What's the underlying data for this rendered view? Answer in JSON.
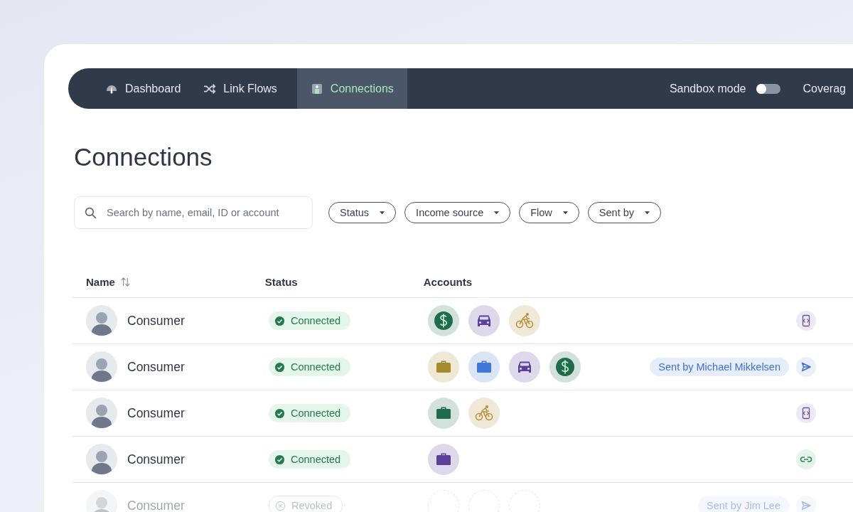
{
  "nav": {
    "tabs": [
      {
        "label": "Dashboard",
        "kind": "gauge",
        "selected": false
      },
      {
        "label": "Link Flows",
        "kind": "shuffle",
        "selected": false
      },
      {
        "label": "Connections",
        "kind": "person",
        "selected": true
      }
    ],
    "sandbox": {
      "label": "Sandbox mode",
      "on": false
    },
    "coverage": "Coverag"
  },
  "title": "Connections",
  "search": {
    "placeholder": "Search by name, email, ID or account"
  },
  "filters": [
    "Status",
    "Income source",
    "Flow",
    "Sent by"
  ],
  "table": {
    "columns": [
      "Name",
      "Status",
      "Accounts"
    ],
    "rows": [
      {
        "name": "Consumer",
        "status": {
          "kind": "connected",
          "label": "Connected"
        },
        "accounts": [
          {
            "kind": "dollar",
            "color": "#1f6b4a"
          },
          {
            "kind": "car",
            "color": "#5b3f98"
          },
          {
            "kind": "bike",
            "color": "#b8923a"
          }
        ],
        "action": {
          "kind": "sdk"
        }
      },
      {
        "name": "Consumer",
        "status": {
          "kind": "connected",
          "label": "Connected"
        },
        "accounts": [
          {
            "kind": "briefcase",
            "color": "#a88a2e"
          },
          {
            "kind": "briefcase",
            "color": "#3f78d8"
          },
          {
            "kind": "car",
            "color": "#5b3f98"
          },
          {
            "kind": "dollar",
            "color": "#1f6b4a"
          }
        ],
        "sent_by": "Sent by Michael Mikkelsen",
        "action": {
          "kind": "send"
        }
      },
      {
        "name": "Consumer",
        "status": {
          "kind": "connected",
          "label": "Connected"
        },
        "accounts": [
          {
            "kind": "briefcase",
            "color": "#1f6b4a"
          },
          {
            "kind": "bike",
            "color": "#b8923a"
          }
        ],
        "action": {
          "kind": "sdk"
        }
      },
      {
        "name": "Consumer",
        "status": {
          "kind": "connected",
          "label": "Connected"
        },
        "accounts": [
          {
            "kind": "briefcase",
            "color": "#5b3f98"
          }
        ],
        "action": {
          "kind": "link"
        }
      },
      {
        "name": "Consumer",
        "status": {
          "kind": "revoked",
          "label": "Revoked"
        },
        "accounts": [
          {
            "kind": "empty"
          },
          {
            "kind": "empty"
          },
          {
            "kind": "empty"
          }
        ],
        "sent_by": "Sent by Jim Lee",
        "action": {
          "kind": "send"
        }
      }
    ]
  }
}
